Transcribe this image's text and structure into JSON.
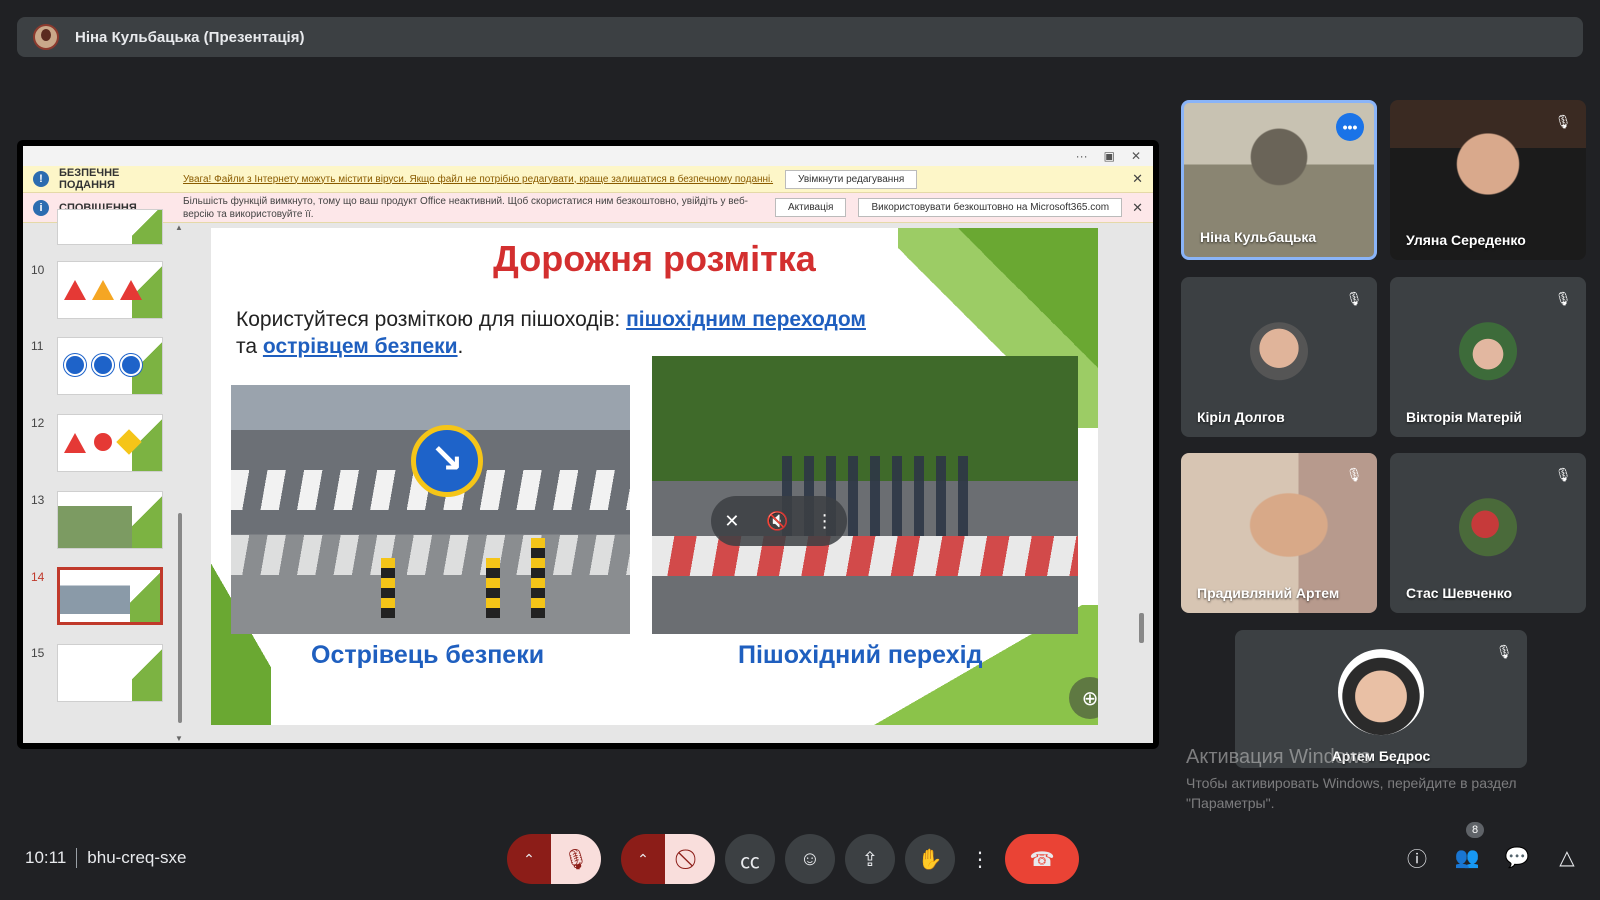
{
  "presenter_bar": {
    "title": "Ніна Кульбацька (Презентація)"
  },
  "ppt": {
    "protected_view": {
      "label": "БЕЗПЕЧНЕ ПОДАННЯ",
      "text": "Увага! Файли з Інтернету можуть містити віруси. Якщо файл не потрібно редагувати, краще залишатися в безпечному поданні.",
      "button": "Увімкнути редагування"
    },
    "notification": {
      "label": "СПОВІЩЕННЯ",
      "text": "Більшість функцій вимкнуто, тому що ваш продукт Office неактивний. Щоб скористатися ним безкоштовно, увійдіть у веб-версію та використовуйте її.",
      "button_activate": "Активація",
      "button_free": "Використовувати безкоштовно на Microsoft365.com"
    },
    "thumbnails": [
      {
        "num": "10"
      },
      {
        "num": "11"
      },
      {
        "num": "12"
      },
      {
        "num": "13"
      },
      {
        "num": "14"
      },
      {
        "num": "15"
      }
    ],
    "slide": {
      "title": "Дорожня розмітка",
      "lead_prefix": "Користуйтеся розміткою для пішоходів: ",
      "link1": "пішохідним переходом",
      "lead_mid": "та ",
      "link2": "острівцем безпеки",
      "lead_suffix": ".",
      "caption_left": "Острівець безпеки",
      "caption_right": "Пішохідний перехід"
    }
  },
  "participants": [
    {
      "name": "Ніна Кульбацька"
    },
    {
      "name": "Уляна Середенко"
    },
    {
      "name": "Кіріл Долгов"
    },
    {
      "name": "Вікторія Матерій"
    },
    {
      "name": "Прадивляний Артем"
    },
    {
      "name": "Стас Шевченко"
    },
    {
      "name": "Артем Бедрос"
    }
  ],
  "watermark": {
    "line1": "Активация Windows",
    "line2": "Чтобы активировать Windows, перейдите в раздел",
    "line3": "\"Параметры\"."
  },
  "meeting": {
    "time": "10:11",
    "code": "bhu-creq-sxe"
  },
  "people_count": "8",
  "colors": {
    "accent": "#8ab4f8",
    "leave": "#ea4335",
    "title_red": "#d32f2f",
    "link_blue": "#1f5fbf"
  }
}
